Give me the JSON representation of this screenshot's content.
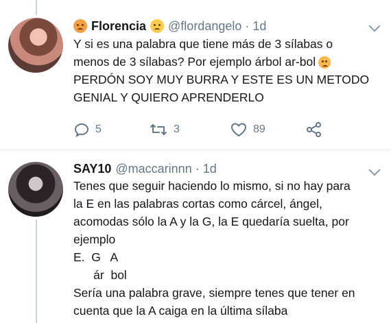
{
  "tweets": [
    {
      "name": "Florencia",
      "handle": "@flordangelo",
      "separator": "·",
      "time": "1d",
      "lines": [
        "Y si es una palabra que tiene más de 3 sílabas o",
        "menos de 3 sílabas? Por ejemplo árbol ar-bol",
        "PERDÓN SOY MUY BURRA Y ESTE ES UN METODO",
        "GENIAL Y QUIERO APRENDERLO"
      ],
      "reply_count": "5",
      "retweet_count": "3",
      "like_count": "89"
    },
    {
      "name": "SAY10",
      "handle": "@maccarinnn",
      "separator": "·",
      "time": "1d",
      "lines": [
        "Tenes que seguir haciendo lo mismo, si no hay para",
        "la E en las palabras cortas como cárcel, ángel,",
        "acomodas sólo la A y la G, la E quedaría suelta, por",
        "ejemplo",
        "E.  G   A",
        "      ár  bol",
        "Sería una palabra grave, siempre tenes que tener en",
        "cuenta que la A caiga en la última sílaba"
      ]
    }
  ],
  "icons": {
    "name_emoji_left": "angry-face-icon",
    "name_emoji_right": "crying-face-icon",
    "inline_emoji": "sad-face-icon",
    "reply": "reply-icon",
    "retweet": "retweet-icon",
    "like": "heart-icon",
    "share": "share-icon",
    "caret": "chevron-down-icon"
  },
  "colors": {
    "text": "#14171a",
    "muted": "#657786",
    "divider": "#e6ecf0"
  }
}
